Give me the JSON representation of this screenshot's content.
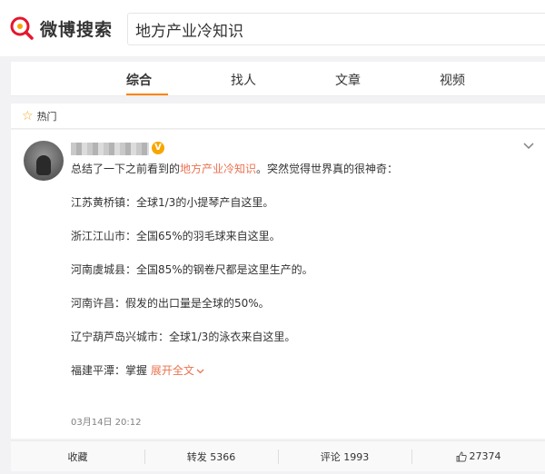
{
  "logo": {
    "text": "微博搜索"
  },
  "search": {
    "value": "地方产业冷知识"
  },
  "tabs": [
    {
      "label": "综合",
      "active": true
    },
    {
      "label": "找人",
      "active": false
    },
    {
      "label": "文章",
      "active": false
    },
    {
      "label": "视频",
      "active": false
    }
  ],
  "section": {
    "label": "热门"
  },
  "post": {
    "intro_prefix": "总结了一下之前看到的",
    "intro_highlight": "地方产业冷知识",
    "intro_suffix": "。突然觉得世界真的很神奇：",
    "lines": [
      "江苏黄桥镇：全球1/3的小提琴产自这里。",
      "浙江江山市：全国65%的羽毛球来自这里。",
      "河南虞城县：全国85%的钢卷尺都是这里生产的。",
      "河南许昌：假发的出口量是全球的50%。",
      "辽宁葫芦岛兴城市：全球1/3的泳衣来自这里。"
    ],
    "last_line": "福建平潭：掌握",
    "expand_label": "展开全文",
    "timestamp": "03月14日 20:12"
  },
  "actions": {
    "favorite": "收藏",
    "repost": "转发 5366",
    "comment": "评论 1993",
    "likes": "27374"
  },
  "colors": {
    "accent": "#ff8200",
    "link": "#eb7350",
    "logo_red": "#e6162d"
  }
}
